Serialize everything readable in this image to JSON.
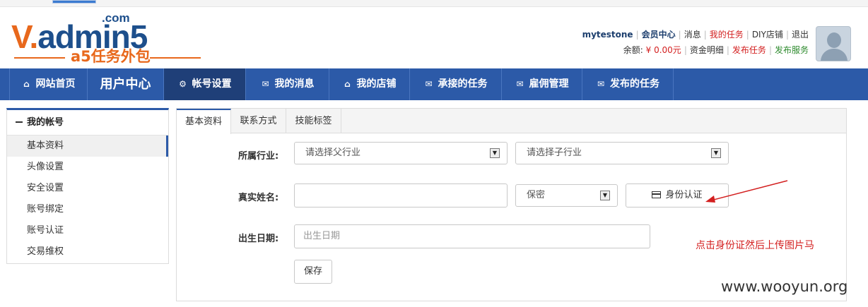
{
  "logo": {
    "dotcom": ".com",
    "wordmark_w": "V.",
    "wordmark_rest": "admin5",
    "tagline": "a5任务外包",
    "brand_blue": "#1d4f8c",
    "brand_orange": "#e8681c"
  },
  "user": {
    "username": "mytestone",
    "member_center": "会员中心",
    "messages": "消息",
    "my_tasks": "我的任务",
    "diy_shop": "DIY店铺",
    "logout": "退出",
    "balance_label": "余额:",
    "balance_value": "¥ 0.00元",
    "fund_details": "资金明细",
    "post_task": "发布任务",
    "post_service": "发布服务",
    "avatar_icon": "user-silhouette-icon"
  },
  "nav": {
    "color": "#2c5aa8",
    "items": [
      {
        "label": "网站首页",
        "icon": "home-icon"
      },
      {
        "label": "用户中心",
        "icon": ""
      },
      {
        "label": "帐号设置",
        "icon": "gears-icon"
      },
      {
        "label": "我的消息",
        "icon": "envelope-icon"
      },
      {
        "label": "我的店铺",
        "icon": "home-icon"
      },
      {
        "label": "承接的任务",
        "icon": "envelope-icon"
      },
      {
        "label": "雇佣管理",
        "icon": "envelope-icon"
      },
      {
        "label": "发布的任务",
        "icon": "envelope-icon"
      }
    ],
    "active_index": 2
  },
  "sidebar": {
    "title": "我的帐号",
    "items": [
      {
        "label": "基本资料",
        "active": true
      },
      {
        "label": "头像设置",
        "active": false
      },
      {
        "label": "安全设置",
        "active": false
      },
      {
        "label": "账号绑定",
        "active": false
      },
      {
        "label": "账号认证",
        "active": false
      },
      {
        "label": "交易维权",
        "active": false
      }
    ]
  },
  "tabs": {
    "items": [
      "基本资料",
      "联系方式",
      "技能标签"
    ],
    "active_index": 0
  },
  "form": {
    "industry_label": "所属行业:",
    "parent_industry": "请选择父行业",
    "child_industry": "请选择子行业",
    "realname_label": "真实姓名:",
    "realname_value": "",
    "privacy_select": "保密",
    "id_verify_button": "身份认证",
    "birthday_label": "出生日期:",
    "birthday_placeholder": "出生日期",
    "save_button": "保存"
  },
  "annotation": {
    "text": "点击身份证然后上传图片马",
    "color": "#d31f1f"
  },
  "watermark": "www.wooyun.org"
}
